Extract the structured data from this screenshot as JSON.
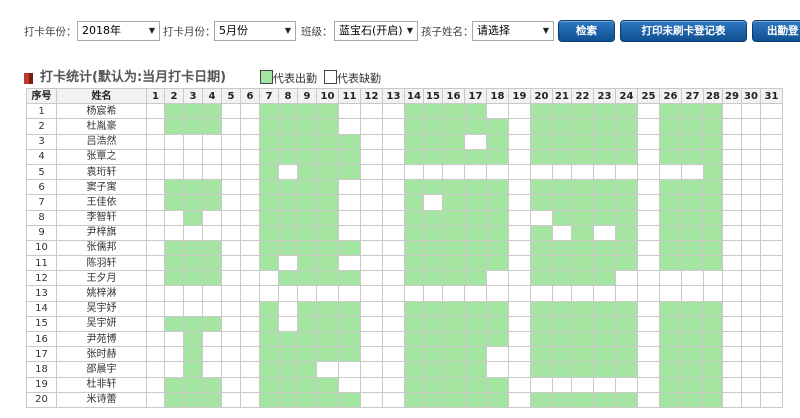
{
  "toolbar": {
    "year_label": "打卡年份：",
    "year_value": "2018年",
    "month_label": "打卡月份：",
    "month_value": "5月份",
    "class_label": "班级：",
    "class_value": "蓝宝石(开启)",
    "child_label": "孩子姓名：",
    "child_value": "请选择",
    "search_btn": "检索",
    "print_btn": "打印未刷卡登记表",
    "export_btn": "出勤登"
  },
  "section": {
    "title": "打卡统计(默认为:当月打卡日期)",
    "legend_present": "代表出勤",
    "legend_absent": "代表缺勤"
  },
  "colors": {
    "present": "#a4e6a1",
    "absent": "#ffffff",
    "button": "#1a5fa8"
  },
  "table": {
    "header_index": "序号",
    "header_name": "姓名",
    "days": [
      "1",
      "2",
      "3",
      "4",
      "5",
      "6",
      "7",
      "8",
      "9",
      "10",
      "11",
      "12",
      "13",
      "14",
      "15",
      "16",
      "17",
      "18",
      "19",
      "20",
      "21",
      "22",
      "23",
      "24",
      "25",
      "26",
      "27",
      "28",
      "29",
      "30",
      "31"
    ],
    "rows": [
      {
        "idx": "1",
        "name": "杨宸希",
        "att": "0111001111000111100111110111"
      },
      {
        "idx": "2",
        "name": "杜胤豪",
        "att": "0111001111000111110111110111"
      },
      {
        "idx": "3",
        "name": "吕浩然",
        "att": "0000001111100111010111110111"
      },
      {
        "idx": "4",
        "name": "张覃之",
        "att": "0000001111100111110111110111"
      },
      {
        "idx": "5",
        "name": "袁珩轩",
        "att": "0000001011100000000000000001"
      },
      {
        "idx": "6",
        "name": "窦子寓",
        "att": "0111001111000111110111110111"
      },
      {
        "idx": "7",
        "name": "王佳依",
        "att": "0111001111000101110111110111"
      },
      {
        "idx": "8",
        "name": "李智轩",
        "att": "0010001111000111110011110111"
      },
      {
        "idx": "9",
        "name": "尹梓旗",
        "att": "0000001111000111110101010111"
      },
      {
        "idx": "10",
        "name": "张儒邦",
        "att": "0111001111100111110111110111"
      },
      {
        "idx": "11",
        "name": "陈羽轩",
        "att": "0111001011000111110111110111"
      },
      {
        "idx": "12",
        "name": "王夕月",
        "att": "0111000111100111100111100000"
      },
      {
        "idx": "13",
        "name": "姚梓淋",
        "att": "0000000000000000000000000000"
      },
      {
        "idx": "14",
        "name": "吴宇妤",
        "att": "0000001011100111110111110111"
      },
      {
        "idx": "15",
        "name": "吴宇妍",
        "att": "0111001011100111110111110111"
      },
      {
        "idx": "16",
        "name": "尹苑博",
        "att": "0010001111100111110111110111"
      },
      {
        "idx": "17",
        "name": "张时赫",
        "att": "0010001111100111100111110111"
      },
      {
        "idx": "18",
        "name": "邵晨宇",
        "att": "0010001110000111100111110111"
      },
      {
        "idx": "19",
        "name": "杜非轩",
        "att": "0111001111000111110000000111"
      },
      {
        "idx": "20",
        "name": "米诗蕾",
        "att": "0111001111100111110111110111"
      }
    ]
  }
}
